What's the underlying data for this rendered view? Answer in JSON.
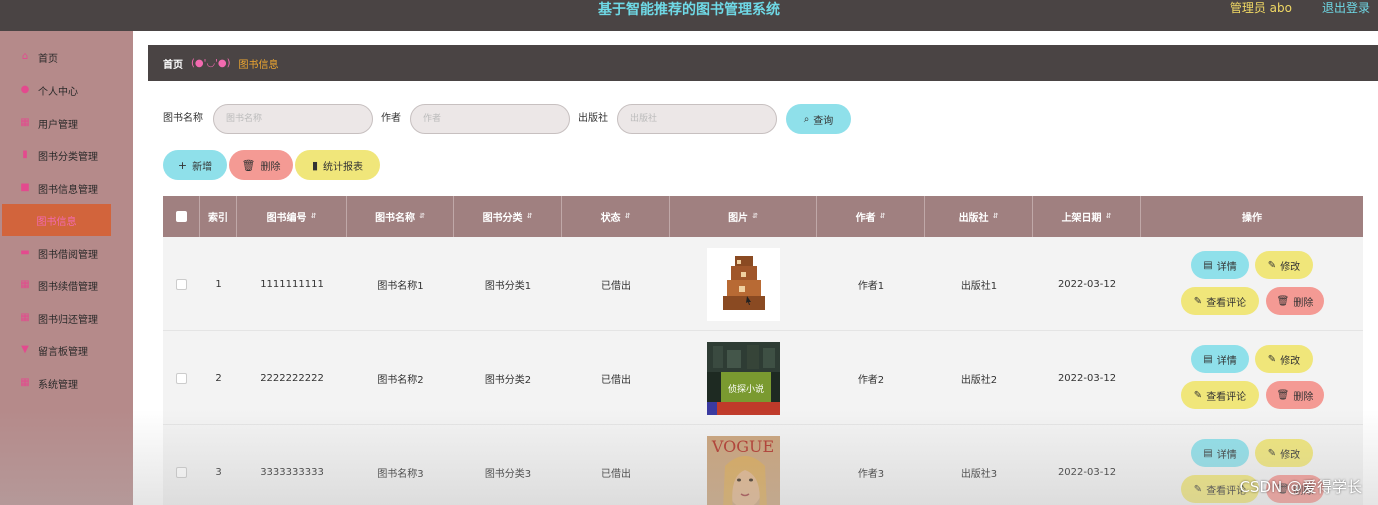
{
  "header": {
    "title": "基于智能推荐的图书管理系统",
    "admin": "管理员 abo",
    "logout": "退出登录"
  },
  "sidebar": {
    "items": [
      {
        "label": "首页",
        "icon": "home-icon"
      },
      {
        "label": "个人中心",
        "icon": "user-icon"
      },
      {
        "label": "用户管理",
        "icon": "grid-icon"
      },
      {
        "label": "图书分类管理",
        "icon": "bar-chart-icon"
      },
      {
        "label": "图书信息管理",
        "icon": "book-icon"
      },
      {
        "label": "图书借阅管理",
        "icon": "card-icon"
      },
      {
        "label": "图书续借管理",
        "icon": "grid-icon"
      },
      {
        "label": "图书归还管理",
        "icon": "grid-icon"
      },
      {
        "label": "留言板管理",
        "icon": "message-icon"
      },
      {
        "label": "系统管理",
        "icon": "grid-icon"
      }
    ],
    "active_sub": "图书信息"
  },
  "breadcrumb": {
    "home": "首页",
    "sep": "(●'◡'●)",
    "current": "图书信息"
  },
  "search": {
    "name_label": "图书名称",
    "name_placeholder": "图书名称",
    "author_label": "作者",
    "author_placeholder": "作者",
    "publisher_label": "出版社",
    "publisher_placeholder": "出版社",
    "query_label": "查询"
  },
  "actions": {
    "add": "新增",
    "delete": "删除",
    "report": "统计报表"
  },
  "table": {
    "headers": [
      "索引",
      "图书编号",
      "图书名称",
      "图书分类",
      "状态",
      "图片",
      "作者",
      "出版社",
      "上架日期",
      "操作"
    ],
    "rows": [
      {
        "index": "1",
        "code": "1111111111",
        "name": "图书名称1",
        "category": "图书分类1",
        "status": "已借出",
        "author": "作者1",
        "publisher": "出版社1",
        "date": "2022-03-12"
      },
      {
        "index": "2",
        "code": "2222222222",
        "name": "图书名称2",
        "category": "图书分类2",
        "status": "已借出",
        "author": "作者2",
        "publisher": "出版社2",
        "date": "2022-03-12"
      },
      {
        "index": "3",
        "code": "3333333333",
        "name": "图书名称3",
        "category": "图书分类3",
        "status": "已借出",
        "author": "作者3",
        "publisher": "出版社3",
        "date": "2022-03-12"
      }
    ],
    "ops": {
      "detail": "详情",
      "edit": "修改",
      "comments": "查看评论",
      "delete": "删除"
    },
    "cover2_text": "侦探小说",
    "cover3_text": "VOGUE"
  },
  "watermark": "CSDN @爱得学长",
  "colors": {
    "header_bg": "#4a4444",
    "sidebar_bg": "#b58a8a",
    "title_color": "#6fd9e6",
    "active_sub_bg": "#d2643c",
    "table_head_bg": "#a08080",
    "btn_cyan": "#8fe0ea",
    "btn_pink": "#f49a94",
    "btn_yellow": "#f0e67a"
  }
}
